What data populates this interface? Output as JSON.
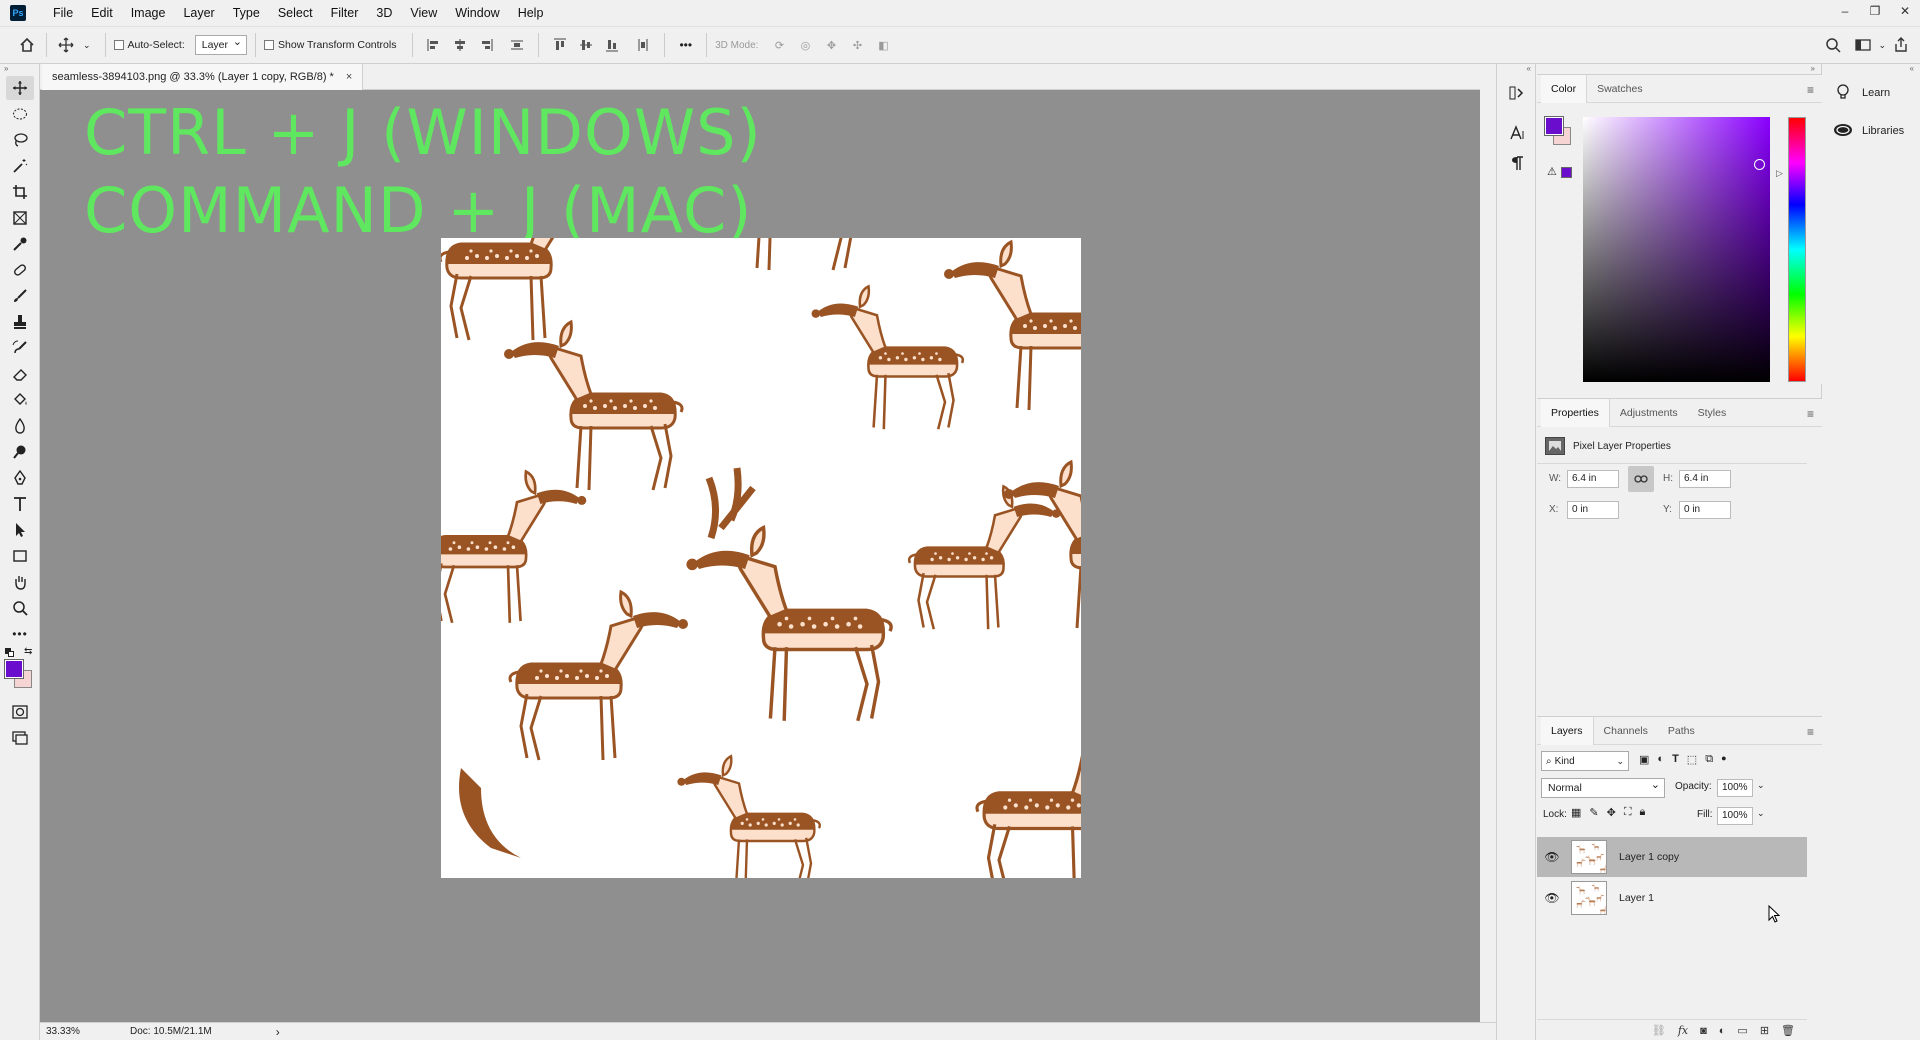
{
  "app": {
    "logo": "Ps",
    "menu": [
      "File",
      "Edit",
      "Image",
      "Layer",
      "Type",
      "Select",
      "Filter",
      "3D",
      "View",
      "Window",
      "Help"
    ],
    "window_controls": [
      "–",
      "❐",
      "✕"
    ]
  },
  "options_bar": {
    "auto_select_label": "Auto-Select:",
    "auto_select_target": "Layer",
    "show_transform_label": "Show Transform Controls",
    "more_label": "•••",
    "mode_3d_label": "3D Mode:"
  },
  "document": {
    "tab_title": "seamless-3894103.png @ 33.3% (Layer 1 copy, RGB/8) *",
    "close_glyph": "×",
    "overlay_line1": "CTRL + J (WINDOWS)",
    "overlay_line2": "COMMAND + J (MAC)",
    "zoom": "33.33%",
    "doc_size": "Doc: 10.5M/21.1M",
    "status_arrow": "›"
  },
  "color_panel": {
    "tabs": [
      "Color",
      "Swatches"
    ],
    "foreground": "#6a0dcc",
    "background": "#f6d4d4",
    "hue_color": "#8a00ff"
  },
  "properties_panel": {
    "tabs": [
      "Properties",
      "Adjustments",
      "Styles"
    ],
    "title": "Pixel Layer Properties",
    "w_label": "W:",
    "w_value": "6.4 in",
    "h_label": "H:",
    "h_value": "6.4 in",
    "x_label": "X:",
    "x_value": "0 in",
    "y_label": "Y:",
    "y_value": "0 in"
  },
  "layers_panel": {
    "tabs": [
      "Layers",
      "Channels",
      "Paths"
    ],
    "kind_label": "Kind",
    "blend_mode": "Normal",
    "opacity_label": "Opacity:",
    "opacity_value": "100%",
    "lock_label": "Lock:",
    "fill_label": "Fill:",
    "fill_value": "100%",
    "layers": [
      {
        "name": "Layer 1 copy",
        "selected": true
      },
      {
        "name": "Layer 1",
        "selected": false
      }
    ]
  },
  "far_right": {
    "items": [
      "Learn",
      "Libraries"
    ]
  },
  "colors": {
    "canvas_bg": "#8f8f8f",
    "overlay_text": "#5fe85f",
    "deer_dark": "#9a5424",
    "deer_light": "#fce0cc"
  }
}
